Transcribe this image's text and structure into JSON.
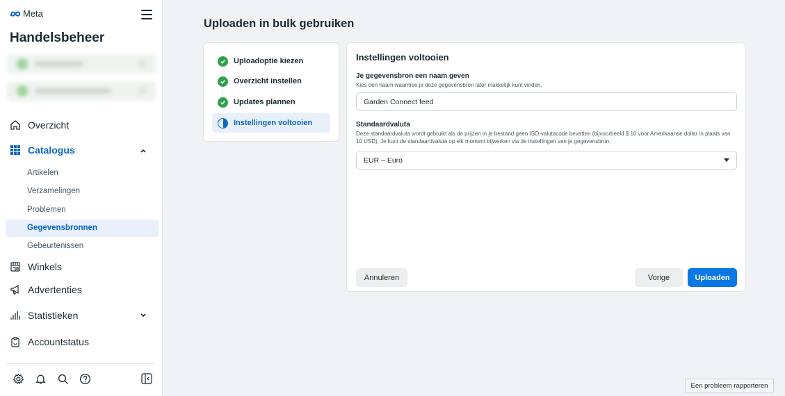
{
  "brand": {
    "logo_text": "Meta",
    "app_title": "Handelsbeheer"
  },
  "sidebar": {
    "nav": [
      {
        "label": "Overzicht",
        "icon": "home-icon"
      },
      {
        "label": "Catalogus",
        "icon": "grid-icon"
      },
      {
        "label": "Winkels",
        "icon": "shop-icon"
      },
      {
        "label": "Advertenties",
        "icon": "megaphone-icon"
      },
      {
        "label": "Statistieken",
        "icon": "bar-chart-icon"
      },
      {
        "label": "Accountstatus",
        "icon": "clipboard-icon"
      }
    ],
    "catalog_sub": [
      {
        "label": "Artikelen"
      },
      {
        "label": "Verzamelingen"
      },
      {
        "label": "Problemen"
      },
      {
        "label": "Gegevensbronnen",
        "active": true
      },
      {
        "label": "Gebeurtenissen"
      }
    ],
    "bottom_icons": [
      "settings-icon",
      "bell-icon",
      "search-icon",
      "help-icon"
    ]
  },
  "page": {
    "title": "Uploaden in bulk gebruiken"
  },
  "steps": [
    {
      "label": "Uploadoptie kiezen",
      "status": "done"
    },
    {
      "label": "Overzicht instellen",
      "status": "done"
    },
    {
      "label": "Updates plannen",
      "status": "done"
    },
    {
      "label": "Instellingen voltooien",
      "status": "current"
    }
  ],
  "form": {
    "heading": "Instellingen voltooien",
    "name_label": "Je gegevensbron een naam geven",
    "name_help": "Kies een naam waarmee je deze gegevensbron later makkelijk kunt vinden.",
    "name_value": "Garden Connect feed",
    "currency_label": "Standaardvaluta",
    "currency_help": "Deze standaardvaluta wordt gebruikt als de prijzen in je bestand geen ISO-valutacode bevatten (bijvoorbeeld $ 10 voor Amerikaanse dollar in plaats van 10 USD). Je kunt de standaardvaluta op elk moment bijwerken via de instellingen van je gegevensbron.",
    "currency_value": "EUR – Euro",
    "cancel_label": "Annuleren",
    "back_label": "Vorige",
    "upload_label": "Uploaden"
  },
  "report_label": "Een probleem rapporteren",
  "colors": {
    "accent": "#0a78e3",
    "success": "#31a24c",
    "active_bg": "#e7f0fb"
  }
}
